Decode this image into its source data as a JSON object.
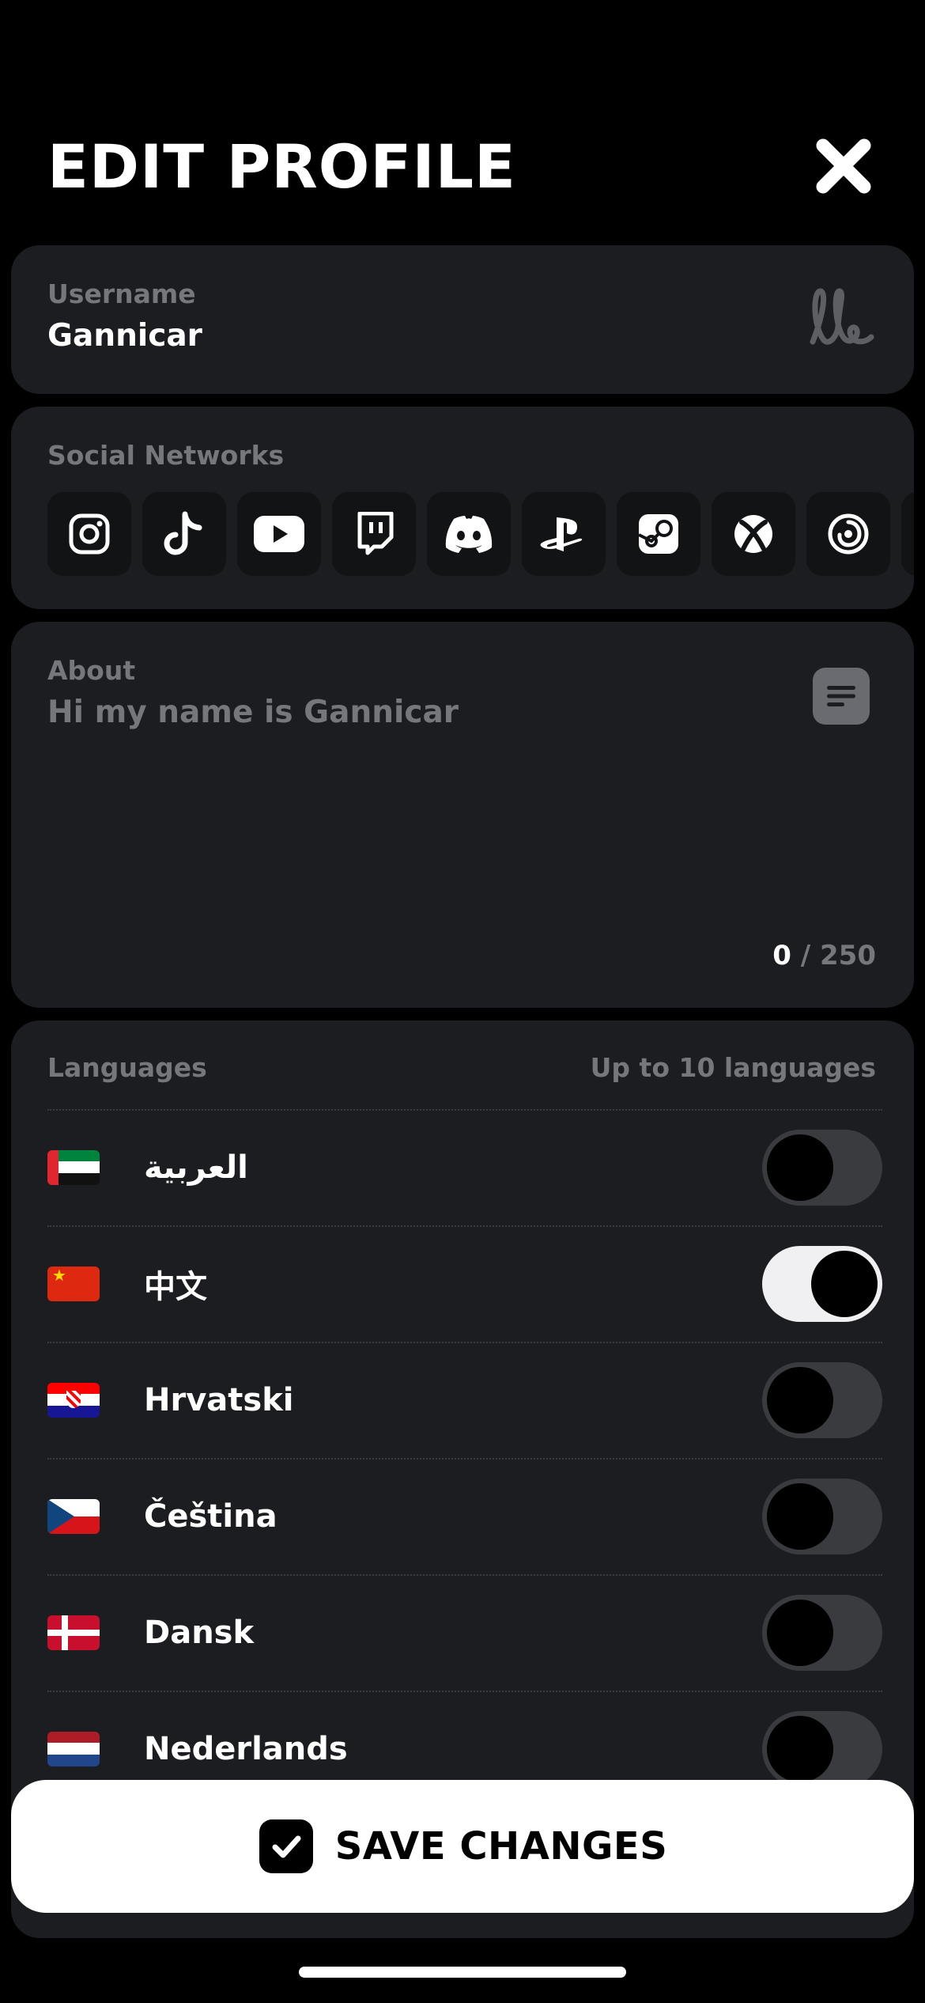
{
  "header": {
    "title": "EDIT PROFILE",
    "close_icon": "close-icon"
  },
  "username": {
    "label": "Username",
    "value": "Gannicar",
    "icon": "signature-icon"
  },
  "social": {
    "label": "Social Networks",
    "networks": [
      {
        "name": "Instagram",
        "icon": "instagram-icon"
      },
      {
        "name": "TikTok",
        "icon": "tiktok-icon"
      },
      {
        "name": "YouTube",
        "icon": "youtube-icon"
      },
      {
        "name": "Twitch",
        "icon": "twitch-icon"
      },
      {
        "name": "Discord",
        "icon": "discord-icon"
      },
      {
        "name": "PlayStation",
        "icon": "playstation-icon"
      },
      {
        "name": "Steam",
        "icon": "steam-icon"
      },
      {
        "name": "Xbox",
        "icon": "xbox-icon"
      },
      {
        "name": "Ubisoft",
        "icon": "ubisoft-icon"
      }
    ]
  },
  "about": {
    "label": "About",
    "placeholder": "Hi my name is Gannicar",
    "count": "0",
    "max": "/ 250",
    "icon": "text-lines-icon"
  },
  "languages": {
    "label": "Languages",
    "hint": "Up to 10 languages",
    "items": [
      {
        "name": "العربية",
        "flag": "uae-flag-icon",
        "enabled": false
      },
      {
        "name": "中文",
        "flag": "china-flag-icon",
        "enabled": true
      },
      {
        "name": "Hrvatski",
        "flag": "croatia-flag-icon",
        "enabled": false
      },
      {
        "name": "Čeština",
        "flag": "czech-flag-icon",
        "enabled": false
      },
      {
        "name": "Dansk",
        "flag": "denmark-flag-icon",
        "enabled": false
      },
      {
        "name": "Nederlands",
        "flag": "netherlands-flag-icon",
        "enabled": false
      }
    ]
  },
  "footer": {
    "save_label": "SAVE CHANGES",
    "save_icon": "checkbox-check-icon"
  },
  "colors": {
    "background": "#000000",
    "card": "#1c1d20",
    "label": "#76777c",
    "toggle_off": "#3a3b3f",
    "toggle_on": "#f0f0f2"
  }
}
